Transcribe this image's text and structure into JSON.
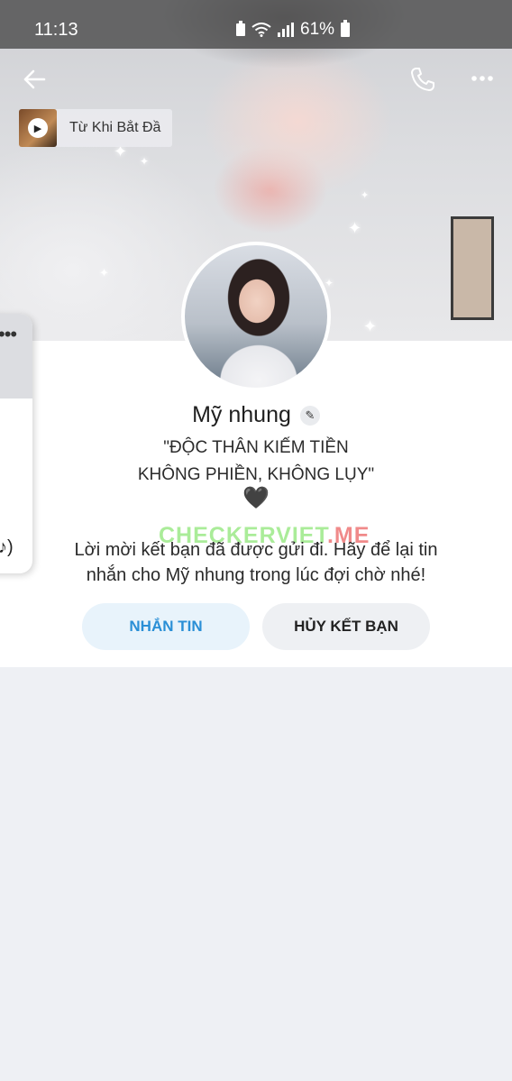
{
  "status_bar": {
    "time": "11:13",
    "battery": "61%"
  },
  "header": {
    "music_title": "Từ Khi Bắt Đầ"
  },
  "profile": {
    "name": "Mỹ nhung",
    "bio_line1": "\"ĐỘC THÂN KIẾM TIỀN",
    "bio_line2": "KHÔNG PHIỀN, KHÔNG LỤY\"",
    "heart": "🖤"
  },
  "watermark": {
    "text": "CHECKERVIET",
    "suffix": ".ME"
  },
  "notice": {
    "line1": "Lời mời kết bạn đã được gửi đi. Hãy để lại tin",
    "line2": "nhắn cho Mỹ nhung trong lúc đợi chờ nhé!"
  },
  "actions": {
    "message_label": "NHẮN TIN",
    "unfriend_label": "HỦY KẾT BẠN"
  },
  "icons": {
    "back": "arrow-left-icon",
    "call": "phone-icon",
    "more": "more-dots-icon",
    "edit": "pencil-icon",
    "play": "play-icon",
    "speaker": "speaker-icon"
  }
}
